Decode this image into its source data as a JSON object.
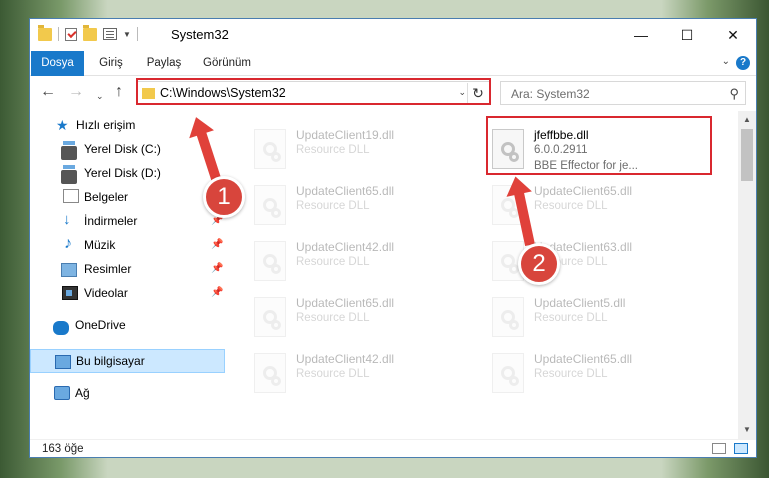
{
  "window": {
    "title": "System32",
    "controls": {
      "minimize": "—",
      "maximize": "☐",
      "close": "✕"
    }
  },
  "ribbon": {
    "tabs": [
      "Dosya",
      "Giriş",
      "Paylaş",
      "Görünüm"
    ],
    "help": "?"
  },
  "address": {
    "path": "C:\\Windows\\System32",
    "search_placeholder": "Ara: System32"
  },
  "sidebar": {
    "items": [
      {
        "label": "Hızlı erişim",
        "icon": "star-icon"
      },
      {
        "label": "Yerel Disk (C:)",
        "icon": "disk-icon"
      },
      {
        "label": "Yerel Disk (D:)",
        "icon": "disk-icon"
      },
      {
        "label": "Belgeler",
        "icon": "document-icon"
      },
      {
        "label": "İndirmeler",
        "icon": "download-icon"
      },
      {
        "label": "Müzik",
        "icon": "music-icon"
      },
      {
        "label": "Resimler",
        "icon": "pictures-icon"
      },
      {
        "label": "Videolar",
        "icon": "video-icon"
      },
      {
        "label": "OneDrive",
        "icon": "cloud-icon"
      },
      {
        "label": "Bu bilgisayar",
        "icon": "computer-icon"
      },
      {
        "label": "Ağ",
        "icon": "network-icon"
      }
    ]
  },
  "files": [
    {
      "name": "UpdateClient19.dll",
      "desc": "Resource DLL",
      "version": ""
    },
    {
      "name": "jfeffbbe.dll",
      "desc": "6.0.0.2911",
      "version": "BBE Effector for je..."
    },
    {
      "name": "UpdateClient65.dll",
      "desc": "Resource DLL",
      "version": ""
    },
    {
      "name": "UpdateClient65.dll",
      "desc": "Resource DLL",
      "version": ""
    },
    {
      "name": "UpdateClient42.dll",
      "desc": "Resource DLL",
      "version": ""
    },
    {
      "name": "UpdateClient63.dll",
      "desc": "Resource DLL",
      "version": ""
    },
    {
      "name": "UpdateClient65.dll",
      "desc": "Resource DLL",
      "version": ""
    },
    {
      "name": "UpdateClient5.dll",
      "desc": "Resource DLL",
      "version": ""
    },
    {
      "name": "UpdateClient42.dll",
      "desc": "Resource DLL",
      "version": ""
    },
    {
      "name": "UpdateClient65.dll",
      "desc": "Resource DLL",
      "version": ""
    }
  ],
  "status": {
    "item_count": "163 öğe"
  },
  "annotations": {
    "step1": "1",
    "step2": "2",
    "color": "#d9282f"
  }
}
